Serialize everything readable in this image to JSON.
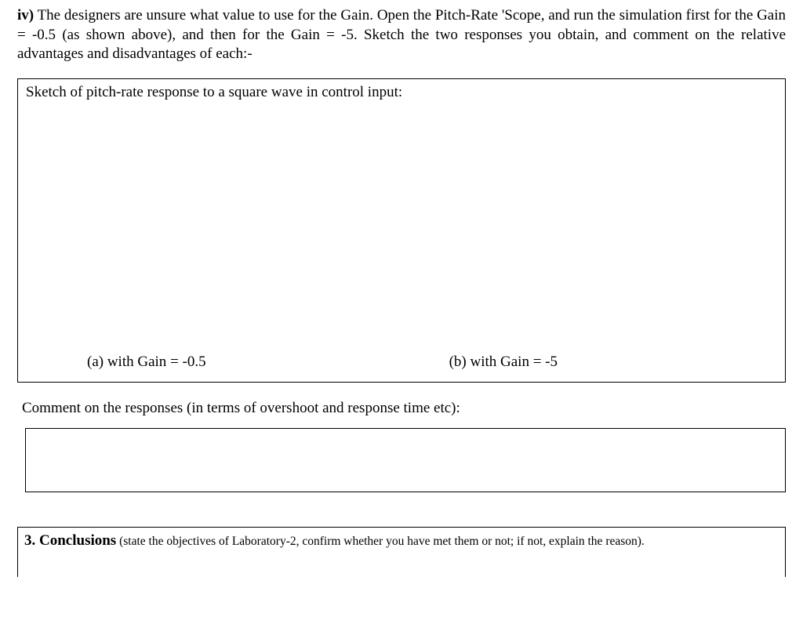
{
  "question": {
    "marker": "iv)",
    "body": "  The designers are unsure what value to use for the Gain.  Open the Pitch-Rate 'Scope, and run the simulation first for the Gain = -0.5 (as shown above), and then for the Gain = -5.   Sketch the two responses you obtain, and comment on the relative advantages and disadvantages of each:-"
  },
  "sketch": {
    "title": "Sketch of pitch-rate response to a square wave in control input:",
    "label_a": "(a) with Gain = -0.5",
    "label_b": "(b) with Gain = -5"
  },
  "comment": {
    "prompt": "Comment on the responses (in terms of overshoot and response time etc):"
  },
  "conclusions": {
    "heading": "3. Conclusions",
    "paren": " (state the objectives of Laboratory-2, confirm whether you have met them or not; if not, explain the reason)."
  }
}
